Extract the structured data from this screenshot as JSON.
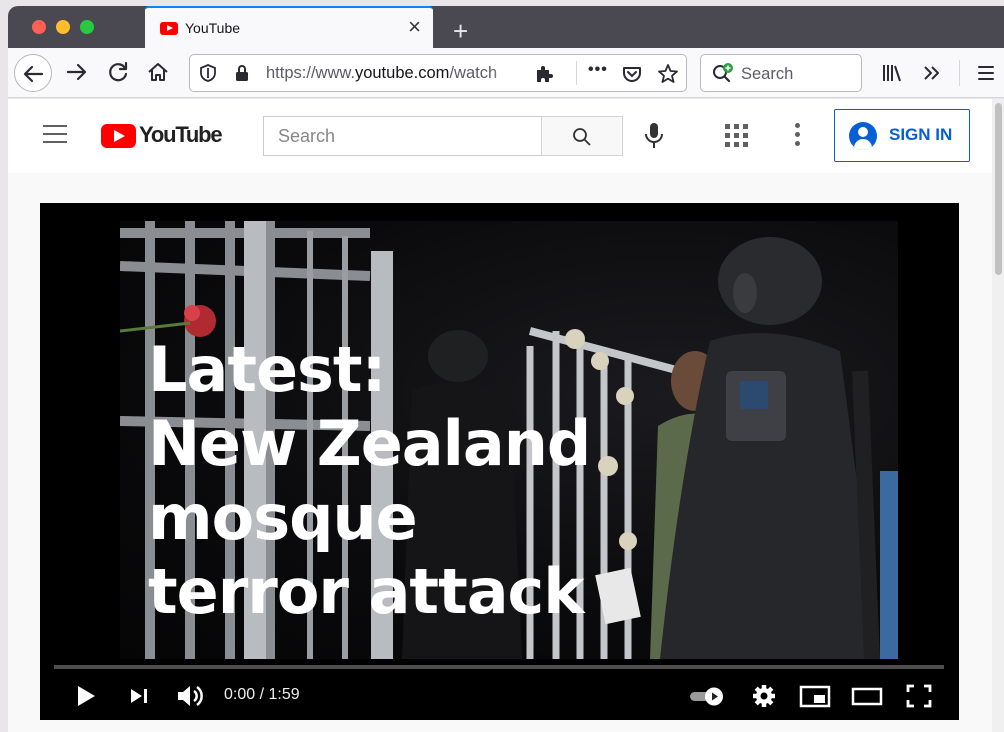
{
  "browser": {
    "tab_title": "YouTube",
    "tab_close": "×",
    "new_tab": "+",
    "url_prefix": "https://www.",
    "url_domain": "youtube.com",
    "url_rest": "/watch",
    "search_placeholder": "Search",
    "overflow_label": "•••"
  },
  "youtube": {
    "logo_text": "YouTube",
    "search_placeholder": "Search",
    "signin_label": "SIGN IN"
  },
  "video": {
    "headline_lines": [
      "Latest:",
      "New Zealand",
      "mosque",
      "terror attack"
    ],
    "time_display": "0:00 / 1:59",
    "progress_fraction": 0
  }
}
